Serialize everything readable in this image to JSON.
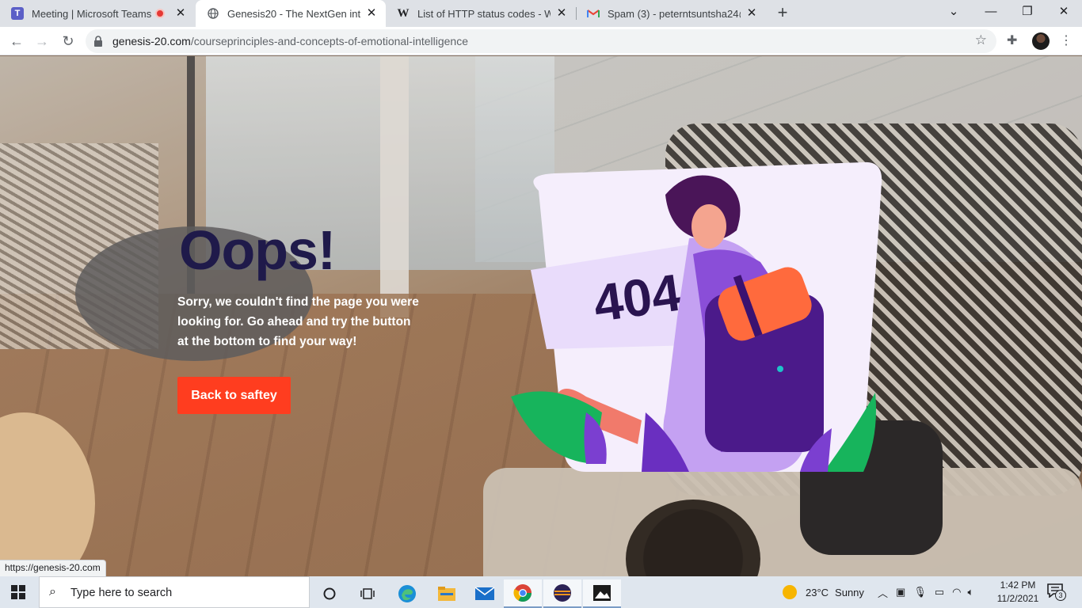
{
  "browser": {
    "tabs": [
      {
        "title": "Meeting | Microsoft Teams",
        "favicon": "teams-icon",
        "recording": true
      },
      {
        "title": "Genesis20 - The NextGen interac",
        "favicon": "globe-icon",
        "active": true
      },
      {
        "title": "List of HTTP status codes - Wikip",
        "favicon": "wikipedia-icon"
      },
      {
        "title": "Spam (3) - peterntsuntsha24@gm",
        "favicon": "gmail-icon"
      }
    ],
    "url_host": "genesis-20.com",
    "url_path": "/courseprinciples-and-concepts-of-emotional-intelligence"
  },
  "page": {
    "heading": "Oops!",
    "description": "Sorry, we couldn't find the page you were looking for. Go ahead and try the button at the bottom to find your way!",
    "button_label": "Back to saftey",
    "illustration_text": "404",
    "accent_color": "#ff3d1f",
    "heading_color": "#1f1a4a"
  },
  "status_bar": {
    "link": "https://genesis-20.com"
  },
  "taskbar": {
    "search_placeholder": "Type here to search",
    "weather_temp": "23°C",
    "weather_text": "Sunny",
    "time": "1:42 PM",
    "date": "11/2/2021",
    "notification_count": "3"
  }
}
